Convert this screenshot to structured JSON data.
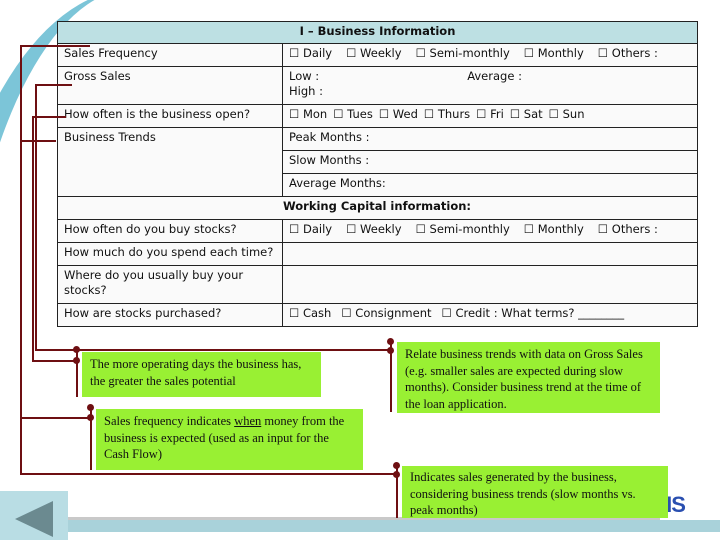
{
  "table": {
    "title": "I – Business Information",
    "rows": {
      "sales_frequency": {
        "label": "Sales Frequency",
        "options": [
          "☐ Daily",
          "☐ Weekly",
          "☐ Semi-monthly",
          "☐ Monthly",
          "☐ Others :"
        ]
      },
      "gross_sales": {
        "label": "Gross Sales",
        "low": "Low :",
        "high": "High :",
        "average": "Average :"
      },
      "open_days": {
        "label": "How often is the business open?",
        "options": [
          "☐ Mon",
          "☐ Tues",
          "☐ Wed",
          "☐ Thurs",
          "☐ Fri",
          "☐ Sat",
          "☐ Sun"
        ]
      },
      "business_trends": {
        "label": "Business Trends",
        "peak": "Peak Months :",
        "slow": "Slow Months :",
        "average": "Average Months:"
      }
    },
    "working_capital_title": "Working Capital information:",
    "wc_rows": {
      "buy_stocks": {
        "label": "How often do you buy stocks?",
        "options": [
          "☐ Daily",
          "☐ Weekly",
          "☐ Semi-monthly",
          "☐ Monthly",
          "☐ Others :"
        ]
      },
      "spend": {
        "label": "How much do you spend each time?"
      },
      "where": {
        "label": "Where do you usually buy your stocks?"
      },
      "purchased": {
        "label": "How are stocks purchased?",
        "options": [
          "☐ Cash",
          "☐ Consignment",
          "☐ Credit : What terms? ________"
        ]
      }
    }
  },
  "notes": {
    "operating_days": "The more operating days the business has, the greater the sales potential",
    "sales_frequency_pre": "Sales frequency indicates ",
    "sales_frequency_em": "when",
    "sales_frequency_post": " money from the business is expected (used as an input for the Cash Flow)",
    "trends": "Relate business trends with data on Gross Sales (e.g. smaller sales are expected during slow months). Consider business trend at the time of the loan application.",
    "gross_sales": "Indicates sales generated by the business, considering business trends (slow months vs. peak months)"
  },
  "logo": "TPIS",
  "colors": {
    "header": "#bde0e3",
    "note": "#99f033",
    "connector": "#6e0f12",
    "accent": "#7cc5d8"
  }
}
